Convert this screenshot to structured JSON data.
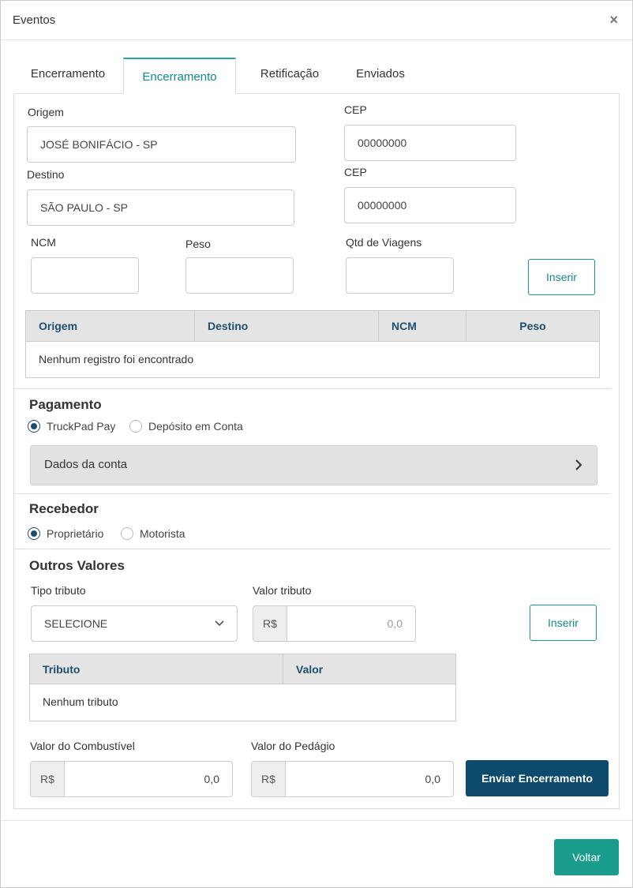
{
  "modal": {
    "title": "Eventos",
    "close_symbol": "×"
  },
  "tabs": [
    {
      "label": "Encerramento",
      "active": false
    },
    {
      "label": "Encerramento",
      "active": true
    },
    {
      "label": "Retificação",
      "active": false
    },
    {
      "label": "Enviados",
      "active": false
    }
  ],
  "route": {
    "origem_label": "Origem",
    "origem_value": "JOSÉ BONIFÁCIO - SP",
    "cep1_label": "CEP",
    "cep1_value": "00000000",
    "destino_label": "Destino",
    "destino_value": "SÃO PAULO - SP",
    "cep2_label": "CEP",
    "cep2_value": "00000000",
    "ncm_label": "NCM",
    "peso_label": "Peso",
    "viagens_label": "Qtd de Viagens",
    "inserir_label": "Inserir"
  },
  "route_table": {
    "columns": [
      "Origem",
      "Destino",
      "NCM",
      "Peso"
    ],
    "empty_text": "Nenhum registro foi encontrado"
  },
  "pagamento": {
    "title": "Pagamento",
    "options": [
      {
        "label": "TruckPad Pay",
        "checked": true
      },
      {
        "label": "Depósito em Conta",
        "checked": false
      }
    ],
    "accordion_label": "Dados da conta"
  },
  "recebedor": {
    "title": "Recebedor",
    "options": [
      {
        "label": "Proprietário",
        "checked": true
      },
      {
        "label": "Motorista",
        "checked": false
      }
    ]
  },
  "outros": {
    "title": "Outros Valores",
    "tipo_label": "Tipo tributo",
    "tipo_value": "SELECIONE",
    "valor_label": "Valor tributo",
    "currency": "R$",
    "valor_placeholder": "0,0",
    "inserir_label": "Inserir"
  },
  "tributo_table": {
    "columns": [
      "Tributo",
      "Valor"
    ],
    "empty_text": "Nenhum tributo"
  },
  "valores": {
    "combustivel_label": "Valor do Combustível",
    "combustivel_currency": "R$",
    "combustivel_value": "0,0",
    "pedagio_label": "Valor do Pedágio",
    "pedagio_currency": "R$",
    "pedagio_value": "0,0",
    "enviar_label": "Enviar Encerramento"
  },
  "footer": {
    "voltar_label": "Voltar"
  },
  "colors": {
    "accent": "#1a9c8c",
    "primary_dark": "#0e4a6b",
    "header_text": "#1f4f6d"
  }
}
